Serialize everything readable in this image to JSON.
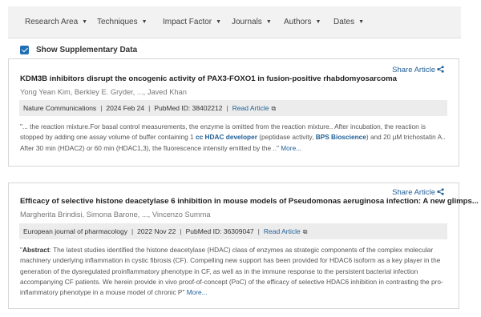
{
  "filters": [
    {
      "label": "Research Area"
    },
    {
      "label": "Techniques"
    },
    {
      "label": "Impact Factor"
    },
    {
      "label": "Journals"
    },
    {
      "label": "Authors"
    },
    {
      "label": "Dates"
    }
  ],
  "supplementary": {
    "label": "Show Supplementary Data",
    "checked": true
  },
  "articles": [
    {
      "share_label": "Share Article",
      "title": "KDM3B inhibitors disrupt the oncogenic activity of PAX3-FOXO1 in fusion-positive rhabdomyosarcoma",
      "authors": "Yong Yean Kim, Berkley E. Gryder, ..., Javed Khan",
      "journal": "Nature Communications",
      "date": "2024 Feb 24",
      "pubmed": "PubMed ID: 38402212",
      "read_label": "Read Article",
      "snippet": {
        "p1": "\"... the reaction mixture.For basal control measurements, the enzyme is omitted from the reaction mixture.. After incubation, the reaction is stopped by adding one assay volume of buffer containing 1 ",
        "hl1": "cc HDAC developer",
        "p2": " (peptidase activity, ",
        "hl2": "BPS Bioscience",
        "p3": ") and 20 µM trichostatin A.. After 30 min (HDAC2) or 60 min (HDAC1,3), the fluorescence intensity emitted by the ..\"",
        "more": " More..."
      }
    },
    {
      "share_label": "Share Article",
      "title": "Efficacy of selective histone deacetylase 6 inhibition in mouse models of Pseudomonas aeruginosa infection: A new glimps...",
      "authors": "Margherita Brindisi, Simona Barone, ..., Vincenzo Summa",
      "journal": "European journal of pharmacology",
      "date": "2022 Nov 22",
      "pubmed": "PubMed ID: 36309047",
      "read_label": "Read Article",
      "snippet": {
        "p0": "\"",
        "bold": "Abstract",
        "p1": ": The latest studies identified the histone deacetylase (HDAC) class of enzymes as strategic components of the complex molecular machinery underlying inflammation in cystic fibrosis (CF). Compelling new support has been provided for HDAC6 isoform as a key player in the generation of the dysregulated proinflammatory phenotype in CF, as well as in the immune response to the persistent bacterial infection accompanying CF patients. We herein provide in vivo proof-of-concept (PoC) of the efficacy of selective HDAC6 inhibition in contrasting the pro-inflammatory phenotype in a mouse model of chronic P\"",
        "more": " More..."
      }
    }
  ]
}
